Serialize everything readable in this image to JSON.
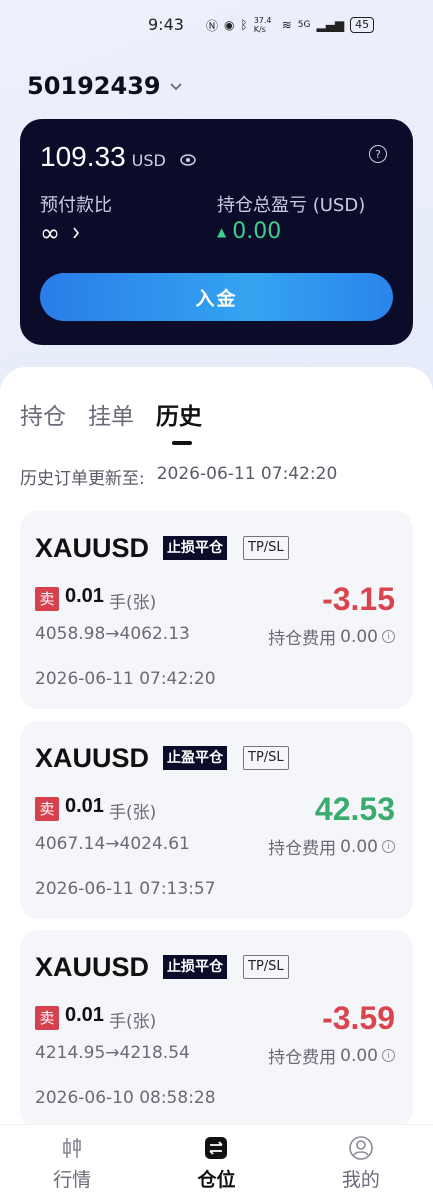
{
  "status_bar": {
    "time": "9:43",
    "network_speed": "37.4 K/s",
    "network_type": "5G",
    "battery": "45"
  },
  "account": {
    "id": "50192439"
  },
  "summary": {
    "balance": "109.33",
    "currency": "USD",
    "margin_ratio_label": "预付款比",
    "margin_ratio_value": "∞",
    "total_pnl_label": "持仓总盈亏 (USD)",
    "total_pnl_value": "0.00",
    "deposit_label": "入金"
  },
  "tabs": [
    {
      "label": "持仓"
    },
    {
      "label": "挂单"
    },
    {
      "label": "历史"
    }
  ],
  "history_update": {
    "label": "历史订单更新至:",
    "time": "2026-06-11 07:42:20"
  },
  "orders": [
    {
      "symbol": "XAUUSD",
      "close_type": "止损平仓",
      "tpsl": "TP/SL",
      "side": "卖",
      "lot": "0.01",
      "lot_unit": "手(张)",
      "prices": "4058.98→4062.13",
      "pnl": "-3.15",
      "fee_label": "持仓费用",
      "fee_value": "0.00",
      "time": "2026-06-11 07:42:20"
    },
    {
      "symbol": "XAUUSD",
      "close_type": "止盈平仓",
      "tpsl": "TP/SL",
      "side": "卖",
      "lot": "0.01",
      "lot_unit": "手(张)",
      "prices": "4067.14→4024.61",
      "pnl": "42.53",
      "fee_label": "持仓费用",
      "fee_value": "0.00",
      "time": "2026-06-11 07:13:57"
    },
    {
      "symbol": "XAUUSD",
      "close_type": "止损平仓",
      "tpsl": "TP/SL",
      "side": "卖",
      "lot": "0.01",
      "lot_unit": "手(张)",
      "prices": "4214.95→4218.54",
      "pnl": "-3.59",
      "fee_label": "持仓费用",
      "fee_value": "0.00",
      "time": "2026-06-10 08:58:28"
    }
  ],
  "bottom_nav": [
    {
      "label": "行情",
      "icon": "candlestick-icon"
    },
    {
      "label": "仓位",
      "icon": "swap-icon"
    },
    {
      "label": "我的",
      "icon": "profile-icon"
    }
  ],
  "colors": {
    "card_dark": "#0b0b2a",
    "accent_blue": "#2a7de8",
    "profit_green": "#3cab6f",
    "loss_red": "#d9454f"
  }
}
